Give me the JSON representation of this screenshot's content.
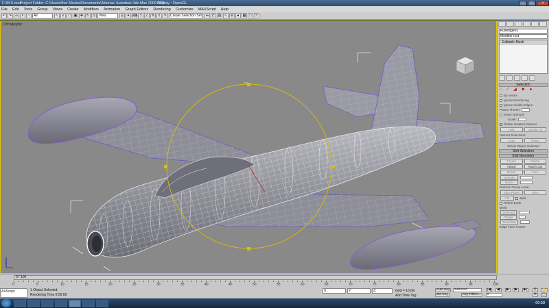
{
  "titlebar": {
    "file": "F-84-5.max",
    "project": "Project Folder: C:\\Users\\Ihor Mesler\\Documents\\3dsmax",
    "app": "Autodesk 3ds Max  2009 SP1",
    "display": "Display : OpenGL"
  },
  "menu": [
    "File",
    "Edit",
    "Tools",
    "Group",
    "Views",
    "Create",
    "Modifiers",
    "Animation",
    "Graph Editors",
    "Rendering",
    "Customize",
    "MAXScript",
    "Help"
  ],
  "toolbar": {
    "filter_value": "All",
    "refcoord_value": "View",
    "selection_set": "Create Selection Set"
  },
  "viewport": {
    "label": "Orthographic"
  },
  "command_panel": {
    "object_name": "Fuselage01",
    "modifier_list": "Modifier List",
    "stack_item": "Editable Mesh",
    "rollouts": {
      "selection": "Selection",
      "by_vertex": "By Vertex",
      "ignore_backfacing": "Ignore Backfacing",
      "ignore_visible_edges": "Ignore Visible Edges",
      "planar_thresh": "Planar Thresh:",
      "planar_thresh_value": "45.0",
      "show_normals": "Show Normals",
      "scale": "Scale:",
      "scale_value": "20.0",
      "delete_isolated": "Delete Isolated Vertices",
      "hide": "Hide",
      "unhide_all": "Unhide All",
      "named_selections": "Named Selections:",
      "copy": "Copy",
      "paste": "Paste",
      "whole_object": "Whole Object Selected",
      "soft_selection": "Soft Selection",
      "edit_geometry": "Edit Geometry",
      "create": "Create",
      "delete": "Delete",
      "attach": "Attach",
      "attach_list": "Attach List",
      "break": "Break",
      "turn": "Turn",
      "extrude": "Extrude",
      "extrude_value": "0.0in",
      "bevel": "Bevel",
      "bevel_value": "0.0in",
      "normal": "Normal:",
      "group": "Group",
      "local": "Local",
      "slice_plane": "Slice Plane",
      "slice": "Slice",
      "cut": "Cut",
      "split": "Split",
      "refine_ends": "Refine Ends",
      "weld": "Weld",
      "selected": "Selected",
      "selected_value": "0.1in",
      "target": "Target",
      "target_value": "4",
      "tessellate": "Tessellate",
      "tessellate_value": "25.0",
      "edge": "Edge",
      "face_center": "Face-Center"
    }
  },
  "timeline": {
    "frame": "0 / 100",
    "ticks": [
      "0",
      "5",
      "10",
      "15",
      "20",
      "25",
      "30",
      "35",
      "40",
      "45",
      "50",
      "55",
      "60",
      "65",
      "70",
      "75",
      "80",
      "85",
      "90",
      "95",
      "100"
    ]
  },
  "status": {
    "maxscript": "AXScript",
    "selected": "1 Object Selected",
    "rendering": "Rendering Time  0:00:00",
    "x_label": "X:",
    "y_label": "Y:",
    "z_label": "Z:",
    "grid": "Grid = 10.0in",
    "add_time_tag": "Add Time Tag",
    "auto_key": "Auto Key",
    "selected_dd": "Selected",
    "set_key": "Set Key",
    "key_filters": "Key Filters...",
    "frame_value": "0"
  },
  "taskbar": {
    "clock": "00:58"
  },
  "colors": {
    "viewport_bg": "#898989",
    "wire_white": "#ffffff",
    "wire_purple": "#8a5ad0",
    "gizmo_yellow": "#d8c000",
    "taskbar": "#1c3150"
  }
}
